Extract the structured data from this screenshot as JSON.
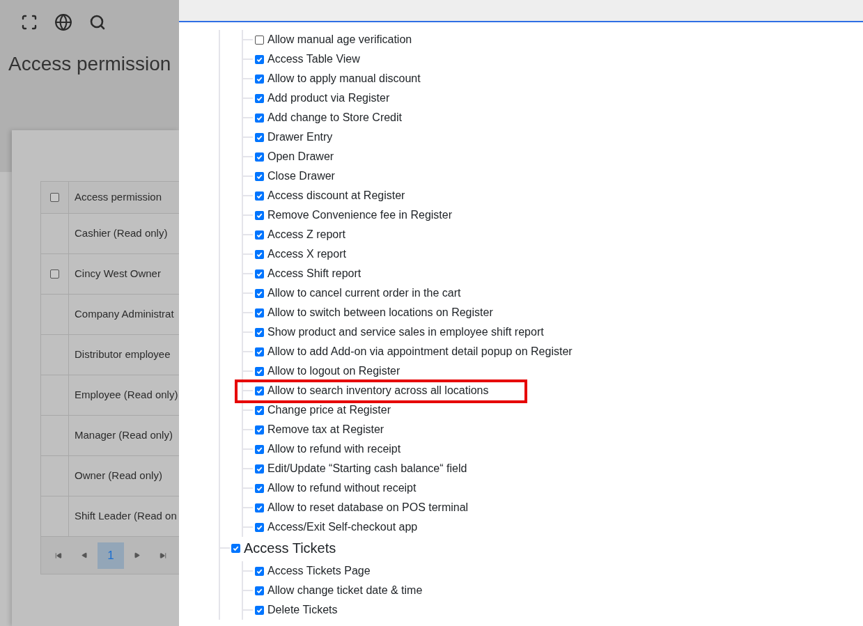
{
  "page": {
    "title": "Access permission"
  },
  "table": {
    "header": {
      "label": "Access permission",
      "checked": false
    },
    "rows": [
      {
        "label": "Cashier (Read only)"
      },
      {
        "label": "Cincy West Owner",
        "checked": false
      },
      {
        "label": "Company Administrat"
      },
      {
        "label": "Distributor employee"
      },
      {
        "label": "Employee (Read only)"
      },
      {
        "label": "Manager (Read only)"
      },
      {
        "label": "Owner (Read only)"
      },
      {
        "label": "Shift Leader (Read on"
      }
    ],
    "pagination": {
      "pages": [
        {
          "label": "1",
          "selected": true
        }
      ]
    }
  },
  "tree": [
    {
      "children": [
        {
          "label": "Allow manual age verification",
          "checked": false,
          "highlighted": false
        },
        {
          "label": "Access Table View",
          "checked": true,
          "highlighted": false
        },
        {
          "label": "Allow to apply manual discount",
          "checked": true,
          "highlighted": false
        },
        {
          "label": "Add product via Register",
          "checked": true,
          "highlighted": false
        },
        {
          "label": "Add change to Store Credit",
          "checked": true,
          "highlighted": false
        },
        {
          "label": "Drawer Entry",
          "checked": true,
          "highlighted": false
        },
        {
          "label": "Open Drawer",
          "checked": true,
          "highlighted": false
        },
        {
          "label": "Close Drawer",
          "checked": true,
          "highlighted": false
        },
        {
          "label": "Access discount at Register",
          "checked": true,
          "highlighted": false
        },
        {
          "label": "Remove Convenience fee in Register",
          "checked": true,
          "highlighted": false
        },
        {
          "label": "Access Z report",
          "checked": true,
          "highlighted": false
        },
        {
          "label": "Access X report",
          "checked": true,
          "highlighted": false
        },
        {
          "label": "Access Shift report",
          "checked": true,
          "highlighted": false
        },
        {
          "label": "Allow to cancel current order in the cart",
          "checked": true,
          "highlighted": false
        },
        {
          "label": "Allow to switch between locations on Register",
          "checked": true,
          "highlighted": false
        },
        {
          "label": "Show product and service sales in employee shift report",
          "checked": true,
          "highlighted": false
        },
        {
          "label": "Allow to add Add-on via appointment detail popup on Register",
          "checked": true,
          "highlighted": false
        },
        {
          "label": "Allow to logout on Register",
          "checked": true,
          "highlighted": false
        },
        {
          "label": "Allow to search inventory across all locations",
          "checked": true,
          "highlighted": true
        },
        {
          "label": "Change price at Register",
          "checked": true,
          "highlighted": false
        },
        {
          "label": "Remove tax at Register",
          "checked": true,
          "highlighted": false
        },
        {
          "label": "Allow to refund with receipt",
          "checked": true,
          "highlighted": false
        },
        {
          "label": "Edit/Update “Starting cash balance“ field",
          "checked": true,
          "highlighted": false
        },
        {
          "label": "Allow to refund without receipt",
          "checked": true,
          "highlighted": false
        },
        {
          "label": "Allow to reset database on POS terminal",
          "checked": true,
          "highlighted": false
        },
        {
          "label": "Access/Exit Self-checkout app",
          "checked": true,
          "highlighted": false
        }
      ]
    },
    {
      "label": "Access Tickets",
      "checked": true,
      "children": [
        {
          "label": "Access Tickets Page",
          "checked": true,
          "highlighted": false
        },
        {
          "label": "Allow change ticket date & time",
          "checked": true,
          "highlighted": false
        },
        {
          "label": "Delete Tickets",
          "checked": true,
          "highlighted": false
        }
      ]
    }
  ]
}
